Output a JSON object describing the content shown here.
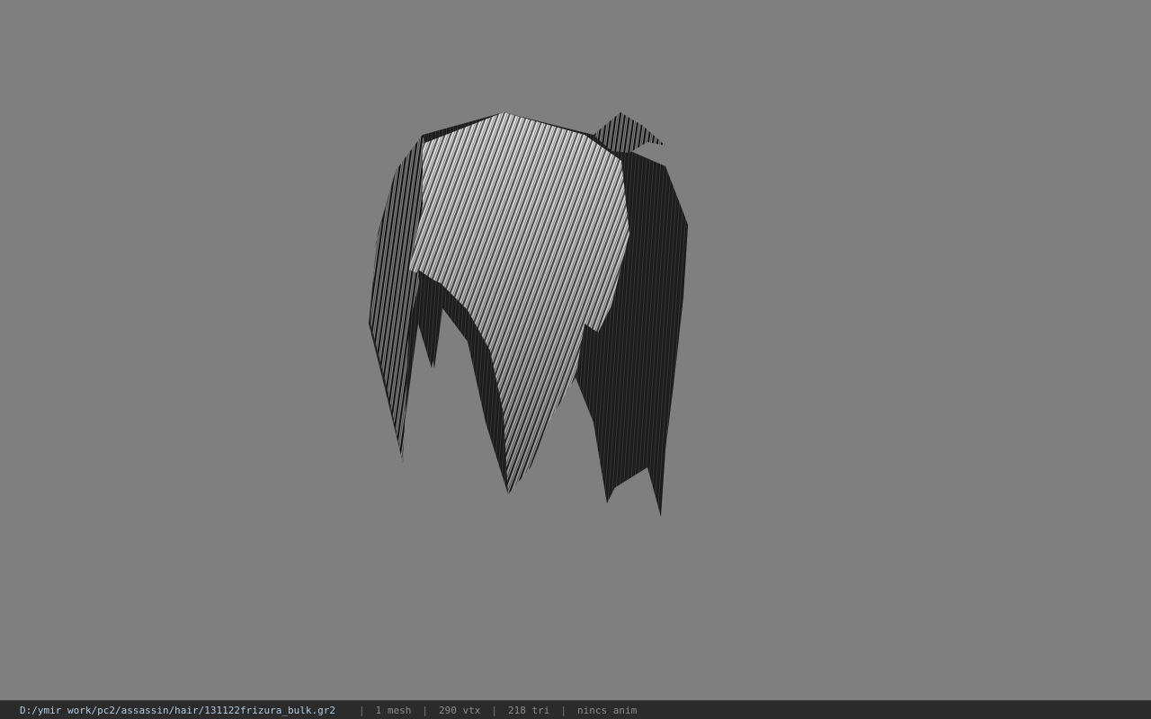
{
  "viewport": {
    "background_color": "#7f7f7f",
    "model_name": "hair mesh preview"
  },
  "status_bar": {
    "file_path": "D:/ymir work/pc2/assassin/hair/131122frizura_bulk.gr2",
    "separator": "|",
    "mesh_count": "1 mesh",
    "vertex_count": "290 vtx",
    "triangle_count": "218 tri",
    "animation": "nincs anim"
  },
  "colors": {
    "status_bar_bg": "#2b2b2b",
    "path_text": "#b4c8dc",
    "info_text": "#8c8c8c"
  }
}
